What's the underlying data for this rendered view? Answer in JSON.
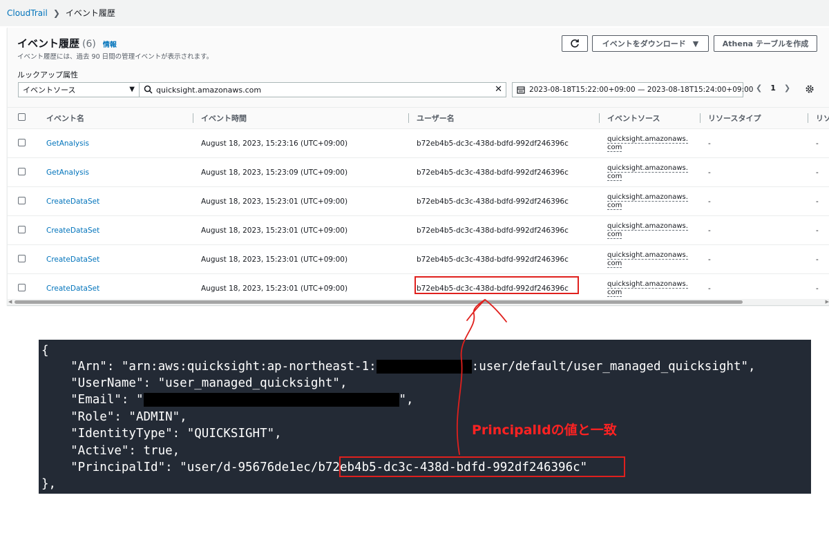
{
  "breadcrumb": {
    "root": "CloudTrail",
    "current": "イベント履歴"
  },
  "header": {
    "title": "イベント履歴",
    "count": "(6)",
    "info": "情報",
    "description": "イベント履歴には、過去 90 日間の管理イベントが表示されます。",
    "download_label": "イベントをダウンロード",
    "athena_label": "Athena テーブルを作成"
  },
  "filters": {
    "lookup_label": "ルックアップ属性",
    "attribute": "イベントソース",
    "search_value": "quicksight.amazonaws.com",
    "date_range": "2023-08-18T15:22:00+09:00 — 2023-08-18T15:24:00+09:00",
    "page": "1"
  },
  "table": {
    "columns": [
      "イベント名",
      "イベント時間",
      "ユーザー名",
      "イベントソース",
      "リソースタイプ",
      "リソ"
    ],
    "rows": [
      {
        "event": "GetAnalysis",
        "time": "August 18, 2023, 15:23:16 (UTC+09:00)",
        "user": "b72eb4b5-dc3c-438d-bdfd-992df246396c",
        "source1": "quicksight.amazonaws.",
        "source2": "com",
        "rtype": "-",
        "res": "-"
      },
      {
        "event": "GetAnalysis",
        "time": "August 18, 2023, 15:23:09 (UTC+09:00)",
        "user": "b72eb4b5-dc3c-438d-bdfd-992df246396c",
        "source1": "quicksight.amazonaws.",
        "source2": "com",
        "rtype": "-",
        "res": "-"
      },
      {
        "event": "CreateDataSet",
        "time": "August 18, 2023, 15:23:01 (UTC+09:00)",
        "user": "b72eb4b5-dc3c-438d-bdfd-992df246396c",
        "source1": "quicksight.amazonaws.",
        "source2": "com",
        "rtype": "-",
        "res": "-"
      },
      {
        "event": "CreateDataSet",
        "time": "August 18, 2023, 15:23:01 (UTC+09:00)",
        "user": "b72eb4b5-dc3c-438d-bdfd-992df246396c",
        "source1": "quicksight.amazonaws.",
        "source2": "com",
        "rtype": "-",
        "res": "-"
      },
      {
        "event": "CreateDataSet",
        "time": "August 18, 2023, 15:23:01 (UTC+09:00)",
        "user": "b72eb4b5-dc3c-438d-bdfd-992df246396c",
        "source1": "quicksight.amazonaws.",
        "source2": "com",
        "rtype": "-",
        "res": "-"
      },
      {
        "event": "CreateDataSet",
        "time": "August 18, 2023, 15:23:01 (UTC+09:00)",
        "user": "b72eb4b5-dc3c-438d-bdfd-992df246396c",
        "source1": "quicksight.amazonaws.",
        "source2": "com",
        "rtype": "-",
        "res": "-"
      }
    ]
  },
  "code": {
    "open": "{",
    "arn_a": "    \"Arn\": \"arn:aws:quicksight:ap-northeast-1:",
    "arn_b": ":user/default/user_managed_quicksight\",",
    "username": "    \"UserName\": \"user_managed_quicksight\",",
    "email_a": "    \"Email\": \"",
    "email_b": "\",",
    "role": "    \"Role\": \"ADMIN\",",
    "identity": "    \"IdentityType\": \"QUICKSIGHT\",",
    "active": "    \"Active\": true,",
    "principal": "    \"PrincipalId\": \"user/d-95676de1ec/b72eb4b5-dc3c-438d-bdfd-992df246396c\"",
    "close": "},"
  },
  "annotation": "PrincipalIdの値と一致",
  "colors": {
    "link": "#0073bb",
    "highlight": "#e0201d",
    "annotation": "#ff2222",
    "code_bg": "#232a35"
  }
}
